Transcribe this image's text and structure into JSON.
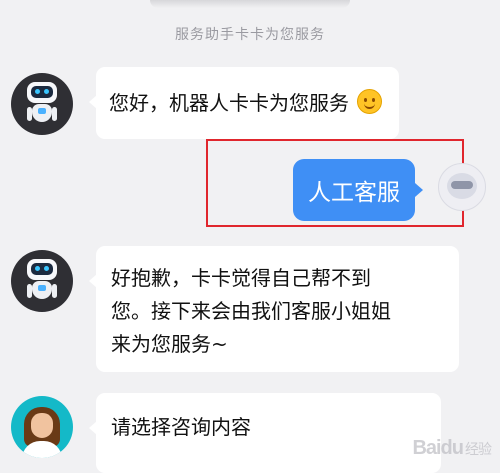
{
  "chat": {
    "system_note": "服务助手卡卡为您服务",
    "messages": [
      {
        "sender": "bot",
        "text": "您好，机器人卡卡为您服务",
        "emoji": "smile-emoji"
      },
      {
        "sender": "user",
        "text": "人工客服"
      },
      {
        "sender": "bot",
        "line1": "好抱歉，卡卡觉得自己帮不到",
        "line2": "您。接下来会由我们客服小姐姐",
        "line3": "来为您服务~"
      },
      {
        "sender": "agent",
        "text": "请选择咨询内容"
      }
    ]
  },
  "watermark": {
    "brand": "Baidu",
    "suffix": "经验"
  },
  "colors": {
    "background": "#f1f1f3",
    "user_bubble": "#3f8ff5",
    "highlight": "#e0262d",
    "agent_avatar": "#14b9c8"
  },
  "icons": {
    "bot_avatar": "robot-avatar-icon",
    "agent_avatar": "customer-service-avatar-icon",
    "user_avatar": "user-avatar-icon",
    "emoji": "smile-emoji-icon"
  }
}
